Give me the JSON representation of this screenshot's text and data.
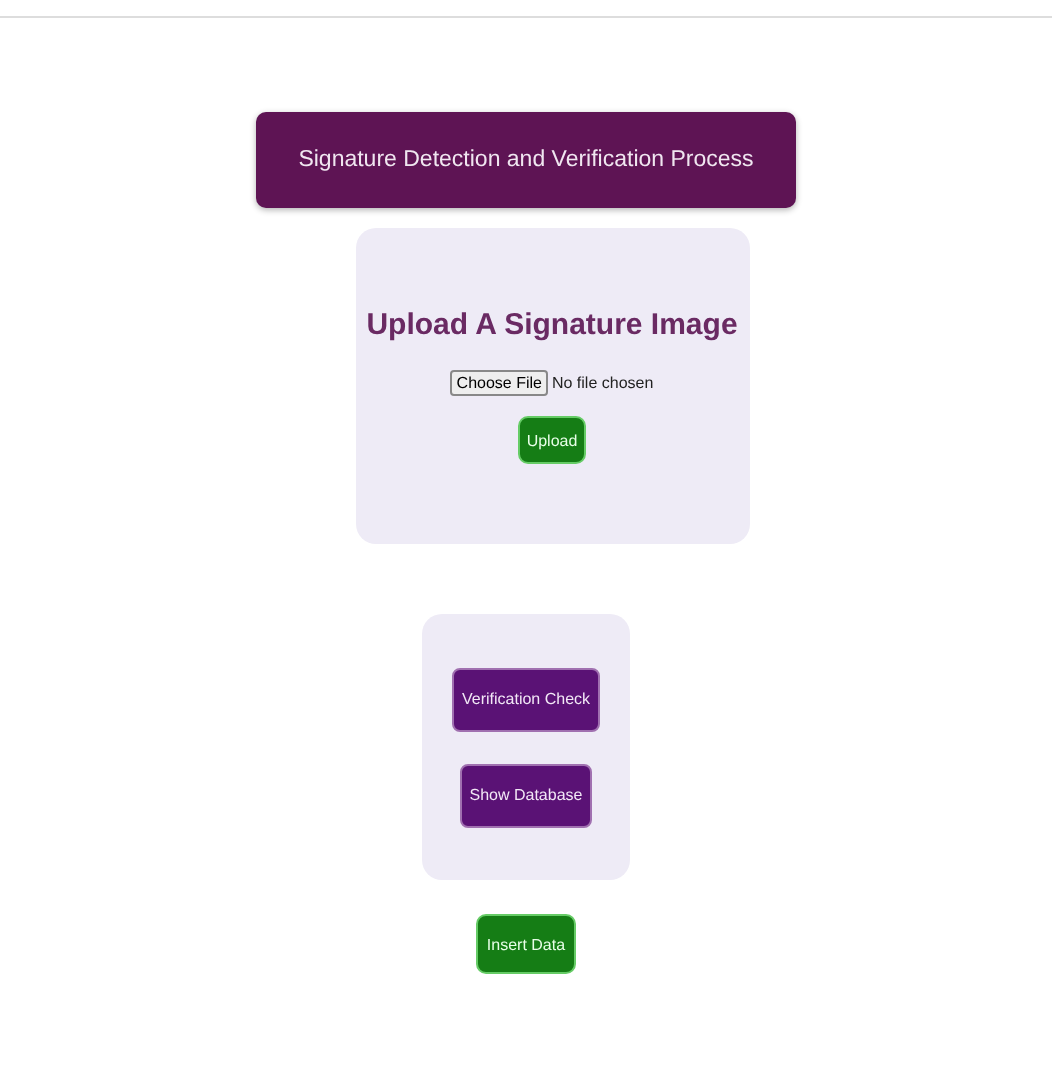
{
  "header": {
    "title": "Signature Detection and Verification Process"
  },
  "upload_card": {
    "heading": "Upload A Signature Image",
    "file_input": {
      "button": "Choose File",
      "status": "No file chosen"
    },
    "submit": "Upload"
  },
  "actions_card": {
    "buttons": [
      "Verification Check",
      "Show Database"
    ]
  },
  "insert_button": "Insert Data"
}
